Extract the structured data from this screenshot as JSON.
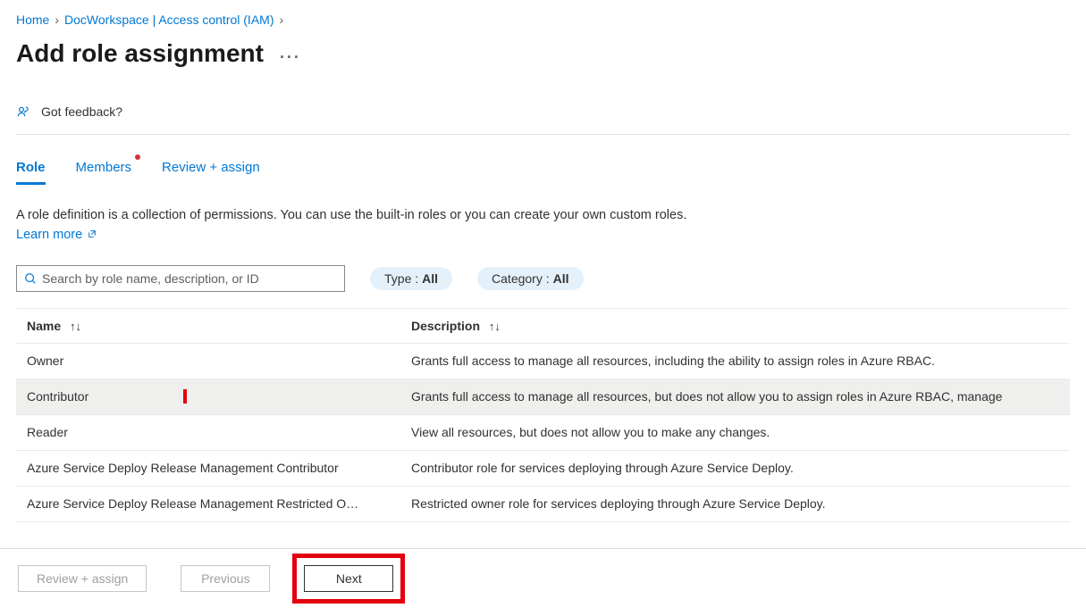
{
  "breadcrumb": {
    "home": "Home",
    "workspace": "DocWorkspace | Access control (IAM)"
  },
  "page": {
    "title": "Add role assignment"
  },
  "feedback": {
    "label": "Got feedback?"
  },
  "tabs": {
    "role": "Role",
    "members": "Members",
    "review": "Review + assign"
  },
  "description": {
    "text": "A role definition is a collection of permissions. You can use the built-in roles or you can create your own custom roles. ",
    "learn_more": "Learn more"
  },
  "search": {
    "placeholder": "Search by role name, description, or ID"
  },
  "filters": {
    "type_label": "Type : ",
    "type_value": "All",
    "category_label": "Category : ",
    "category_value": "All"
  },
  "columns": {
    "name": "Name",
    "description": "Description"
  },
  "roles": [
    {
      "name": "Owner",
      "description": "Grants full access to manage all resources, including the ability to assign roles in Azure RBAC.",
      "selected": false
    },
    {
      "name": "Contributor",
      "description": "Grants full access to manage all resources, but does not allow you to assign roles in Azure RBAC, manage",
      "selected": true
    },
    {
      "name": "Reader",
      "description": "View all resources, but does not allow you to make any changes.",
      "selected": false
    },
    {
      "name": "Azure Service Deploy Release Management Contributor",
      "description": "Contributor role for services deploying through Azure Service Deploy.",
      "selected": false
    },
    {
      "name": "Azure Service Deploy Release Management Restricted O…",
      "description": "Restricted owner role for services deploying through Azure Service Deploy.",
      "selected": false
    }
  ],
  "footer": {
    "review": "Review + assign",
    "previous": "Previous",
    "next": "Next"
  }
}
